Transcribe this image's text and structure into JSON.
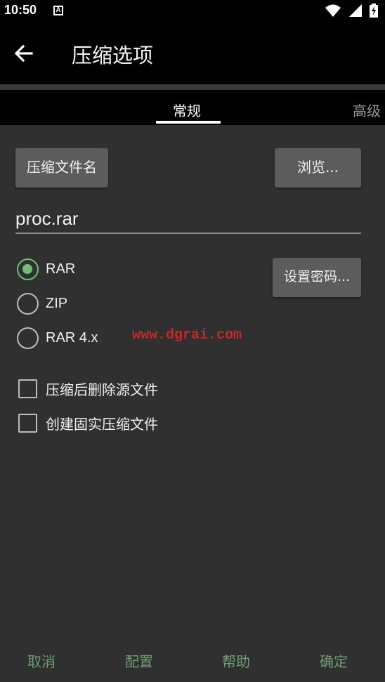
{
  "status_bar": {
    "time": "10:50",
    "notification_icon": "A"
  },
  "app_bar": {
    "title": "压缩选项"
  },
  "tabs": [
    {
      "label": "常规",
      "selected": true
    },
    {
      "label": "高级",
      "selected": false
    }
  ],
  "general": {
    "archive_name_button": "压缩文件名",
    "browse_button": "浏览...",
    "archive_name_value": "proc.rar",
    "set_password_button": "设置密码...",
    "formats": [
      {
        "label": "RAR",
        "checked": true
      },
      {
        "label": "ZIP",
        "checked": false
      },
      {
        "label": "RAR 4.x",
        "checked": false
      }
    ],
    "options": [
      {
        "label": "压缩后删除源文件",
        "checked": false
      },
      {
        "label": "创建固实压缩文件",
        "checked": false
      }
    ]
  },
  "watermark": "www.dgrai.com",
  "bottom_bar": {
    "cancel": "取消",
    "profiles": "配置",
    "help": "帮助",
    "ok": "确定"
  },
  "colors": {
    "accent": "#6fbf73",
    "bottom_text": "#6e9e72",
    "background": "#303030",
    "appbar": "#000000",
    "button": "#5c5c5c"
  }
}
